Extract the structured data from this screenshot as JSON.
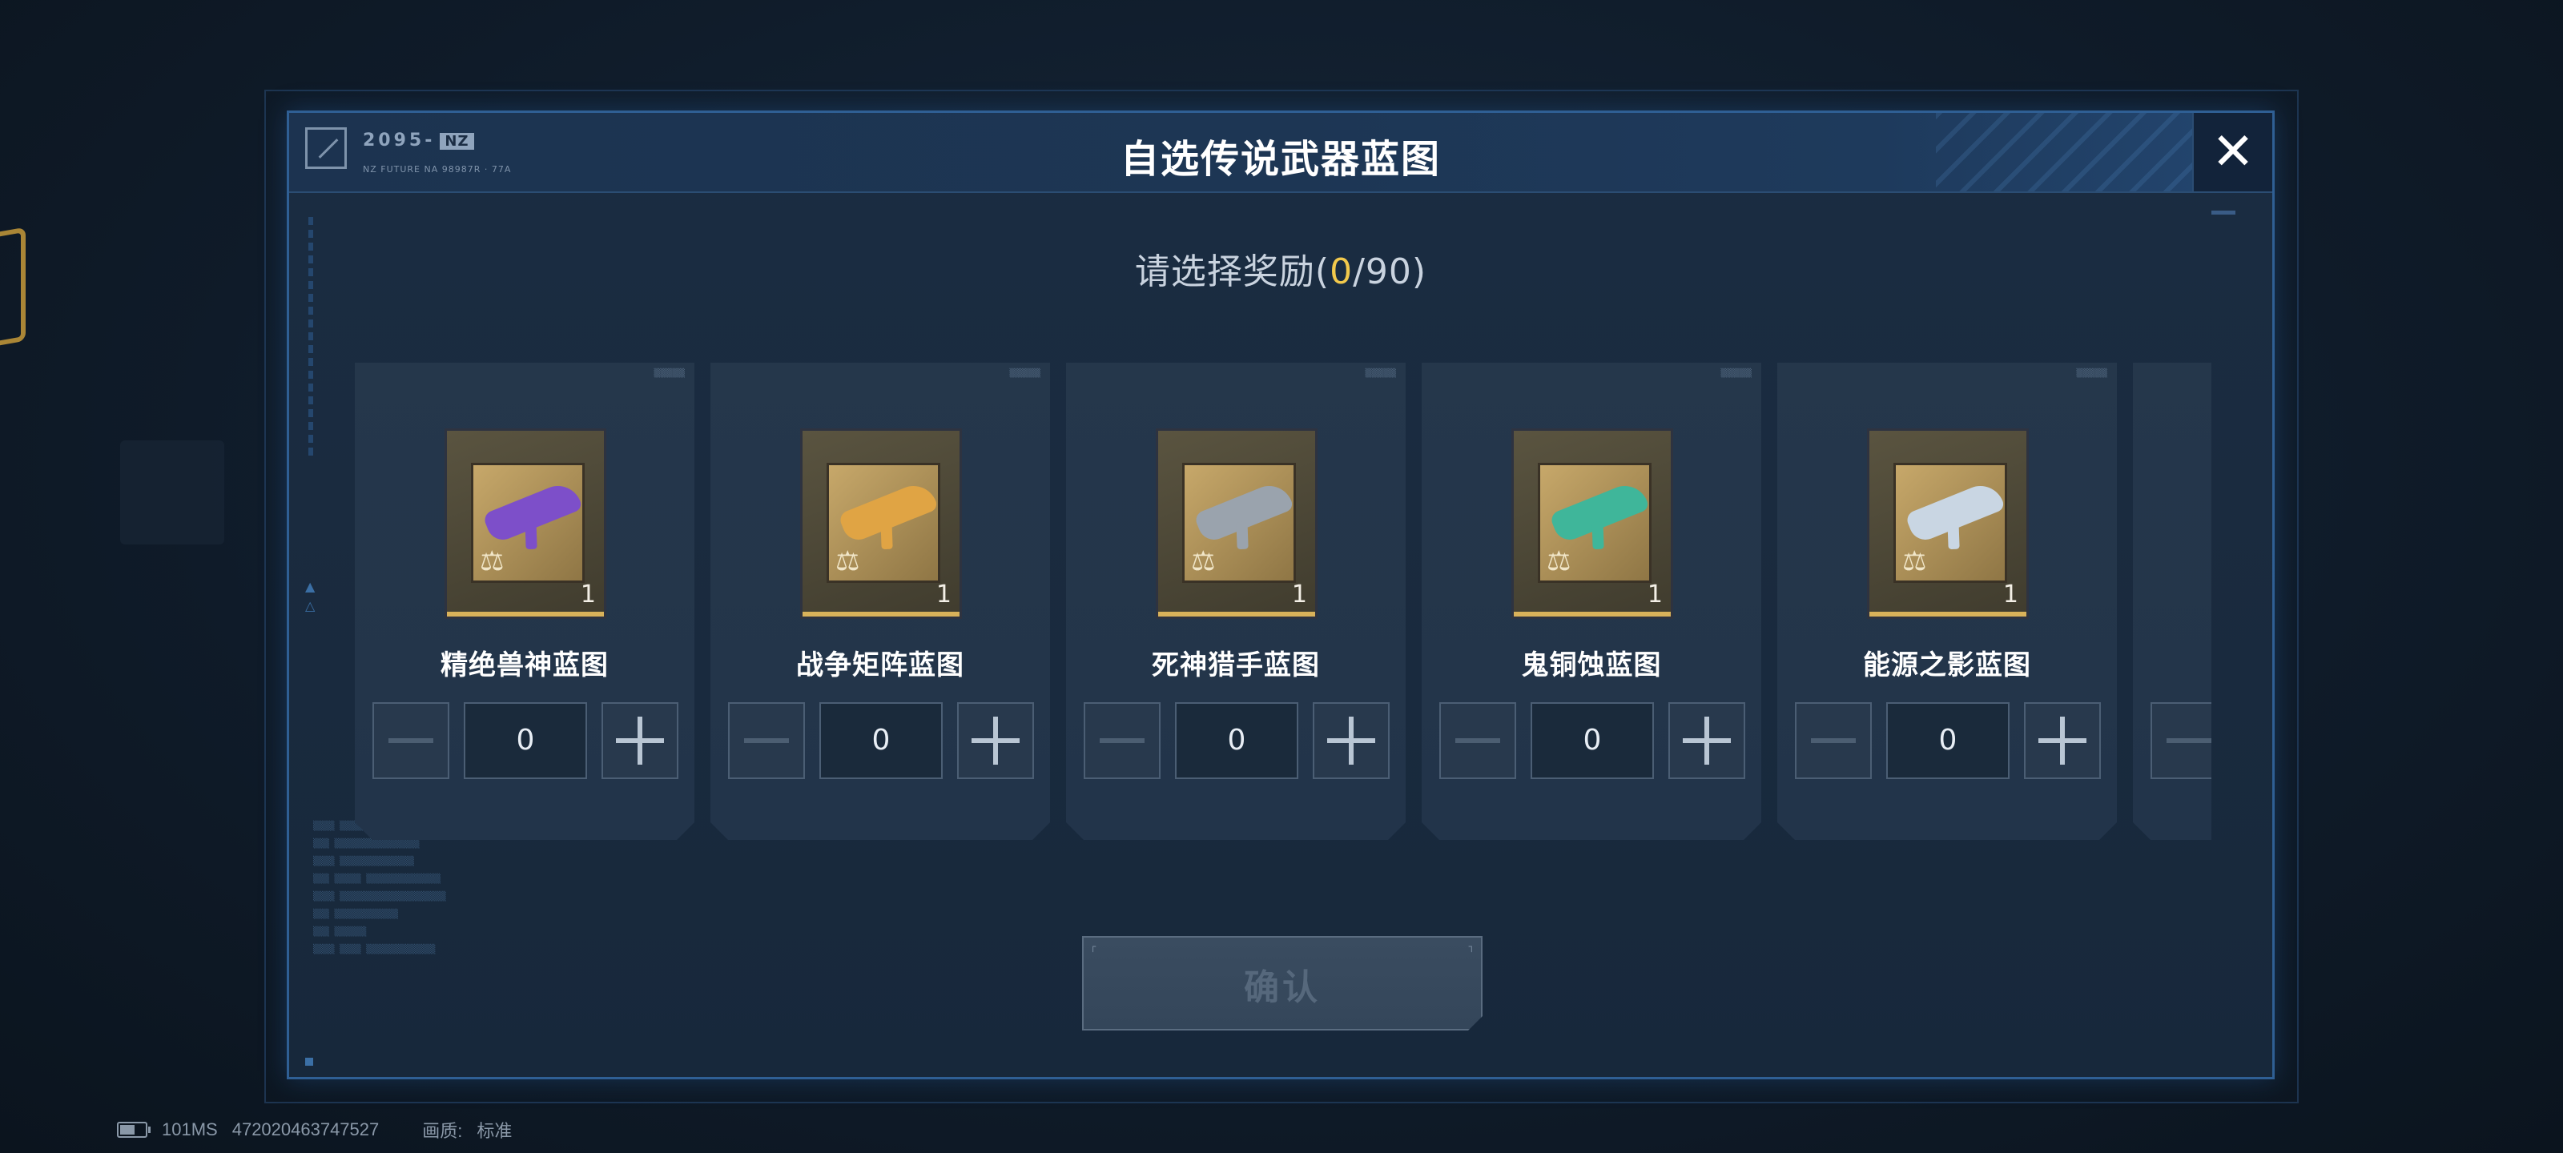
{
  "header": {
    "logo_code": "2095-",
    "logo_tag": "NZ",
    "logo_sub": "NZ FUTURE NA 98987R · 77A",
    "title": "自选传说武器蓝图",
    "close_icon": "close-icon"
  },
  "prompt": {
    "label": "请选择奖励(",
    "selected": "0",
    "total": "/90)"
  },
  "rewards": [
    {
      "name": "精绝兽神蓝图",
      "qty": "1",
      "value": "0",
      "gun_color": "#7d4fc9"
    },
    {
      "name": "战争矩阵蓝图",
      "qty": "1",
      "value": "0",
      "gun_color": "#e0a444"
    },
    {
      "name": "死神猎手蓝图",
      "qty": "1",
      "value": "0",
      "gun_color": "#9aa3ad"
    },
    {
      "name": "鬼铜蚀蓝图",
      "qty": "1",
      "value": "0",
      "gun_color": "#3fb69a"
    },
    {
      "name": "能源之影蓝图",
      "qty": "1",
      "value": "0",
      "gun_color": "#c9d6e3"
    }
  ],
  "confirm": {
    "label": "确认"
  },
  "status": {
    "ping": "101MS",
    "id": "472020463747527",
    "quality_label": "画质:",
    "quality_value": "标准"
  },
  "colors": {
    "accent_gold": "#f2c94c",
    "frame_blue": "#2f5f94"
  }
}
